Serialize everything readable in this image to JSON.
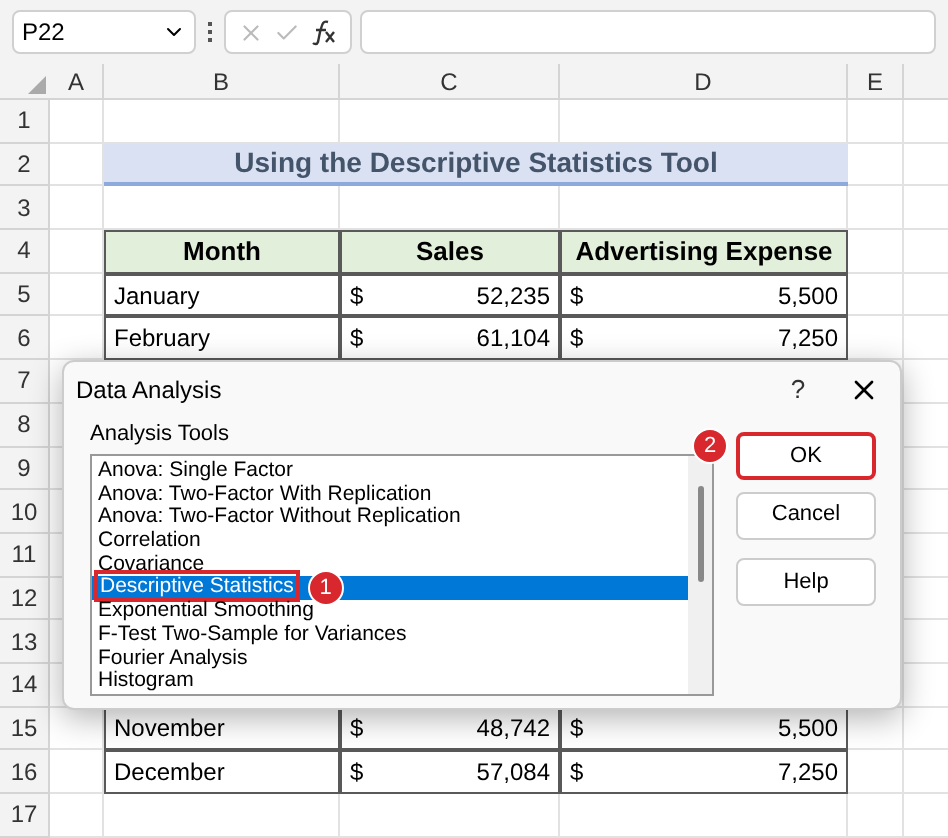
{
  "name_box": "P22",
  "columns": [
    "A",
    "B",
    "C",
    "D",
    "E"
  ],
  "rows": [
    {
      "number": "1",
      "kind": "empty"
    },
    {
      "number": "2",
      "kind": "title",
      "text": "Using the Descriptive Statistics Tool"
    },
    {
      "number": "3",
      "kind": "empty"
    },
    {
      "number": "4",
      "kind": "header",
      "cells": [
        "Month",
        "Sales",
        "Advertising Expense"
      ]
    },
    {
      "number": "5",
      "kind": "data",
      "month": "January",
      "sales_currency": "$",
      "sales": "52,235",
      "expense_currency": "$",
      "expense": "5,500"
    },
    {
      "number": "6",
      "kind": "data",
      "month": "February",
      "sales_currency": "$",
      "sales": "61,104",
      "expense_currency": "$",
      "expense": "7,250"
    },
    {
      "number": "7",
      "kind": "covered"
    },
    {
      "number": "8",
      "kind": "covered"
    },
    {
      "number": "9",
      "kind": "covered"
    },
    {
      "number": "10",
      "kind": "covered"
    },
    {
      "number": "11",
      "kind": "covered"
    },
    {
      "number": "12",
      "kind": "covered"
    },
    {
      "number": "13",
      "kind": "covered"
    },
    {
      "number": "14",
      "kind": "covered"
    },
    {
      "number": "15",
      "kind": "data",
      "month": "November",
      "sales_currency": "$",
      "sales": "48,742",
      "expense_currency": "$",
      "expense": "5,500"
    },
    {
      "number": "16",
      "kind": "data",
      "month": "December",
      "sales_currency": "$",
      "sales": "57,084",
      "expense_currency": "$",
      "expense": "7,250"
    },
    {
      "number": "17",
      "kind": "empty"
    }
  ],
  "dialog": {
    "title": "Data Analysis",
    "help": "?",
    "list_label": "Analysis Tools",
    "items": [
      {
        "label": "Anova: Single Factor",
        "selected": false
      },
      {
        "label": "Anova: Two-Factor With Replication",
        "selected": false
      },
      {
        "label": "Anova: Two-Factor Without Replication",
        "selected": false
      },
      {
        "label": "Correlation",
        "selected": false
      },
      {
        "label": "Covariance",
        "selected": false
      },
      {
        "label": "Descriptive Statistics",
        "selected": true,
        "marker": "1"
      },
      {
        "label": "Exponential Smoothing",
        "selected": false
      },
      {
        "label": "F-Test Two-Sample for Variances",
        "selected": false
      },
      {
        "label": "Fourier Analysis",
        "selected": false
      },
      {
        "label": "Histogram",
        "selected": false
      }
    ],
    "buttons": [
      {
        "label": "OK",
        "marker": "2"
      },
      {
        "label": "Cancel"
      },
      {
        "label": "Help"
      }
    ]
  }
}
